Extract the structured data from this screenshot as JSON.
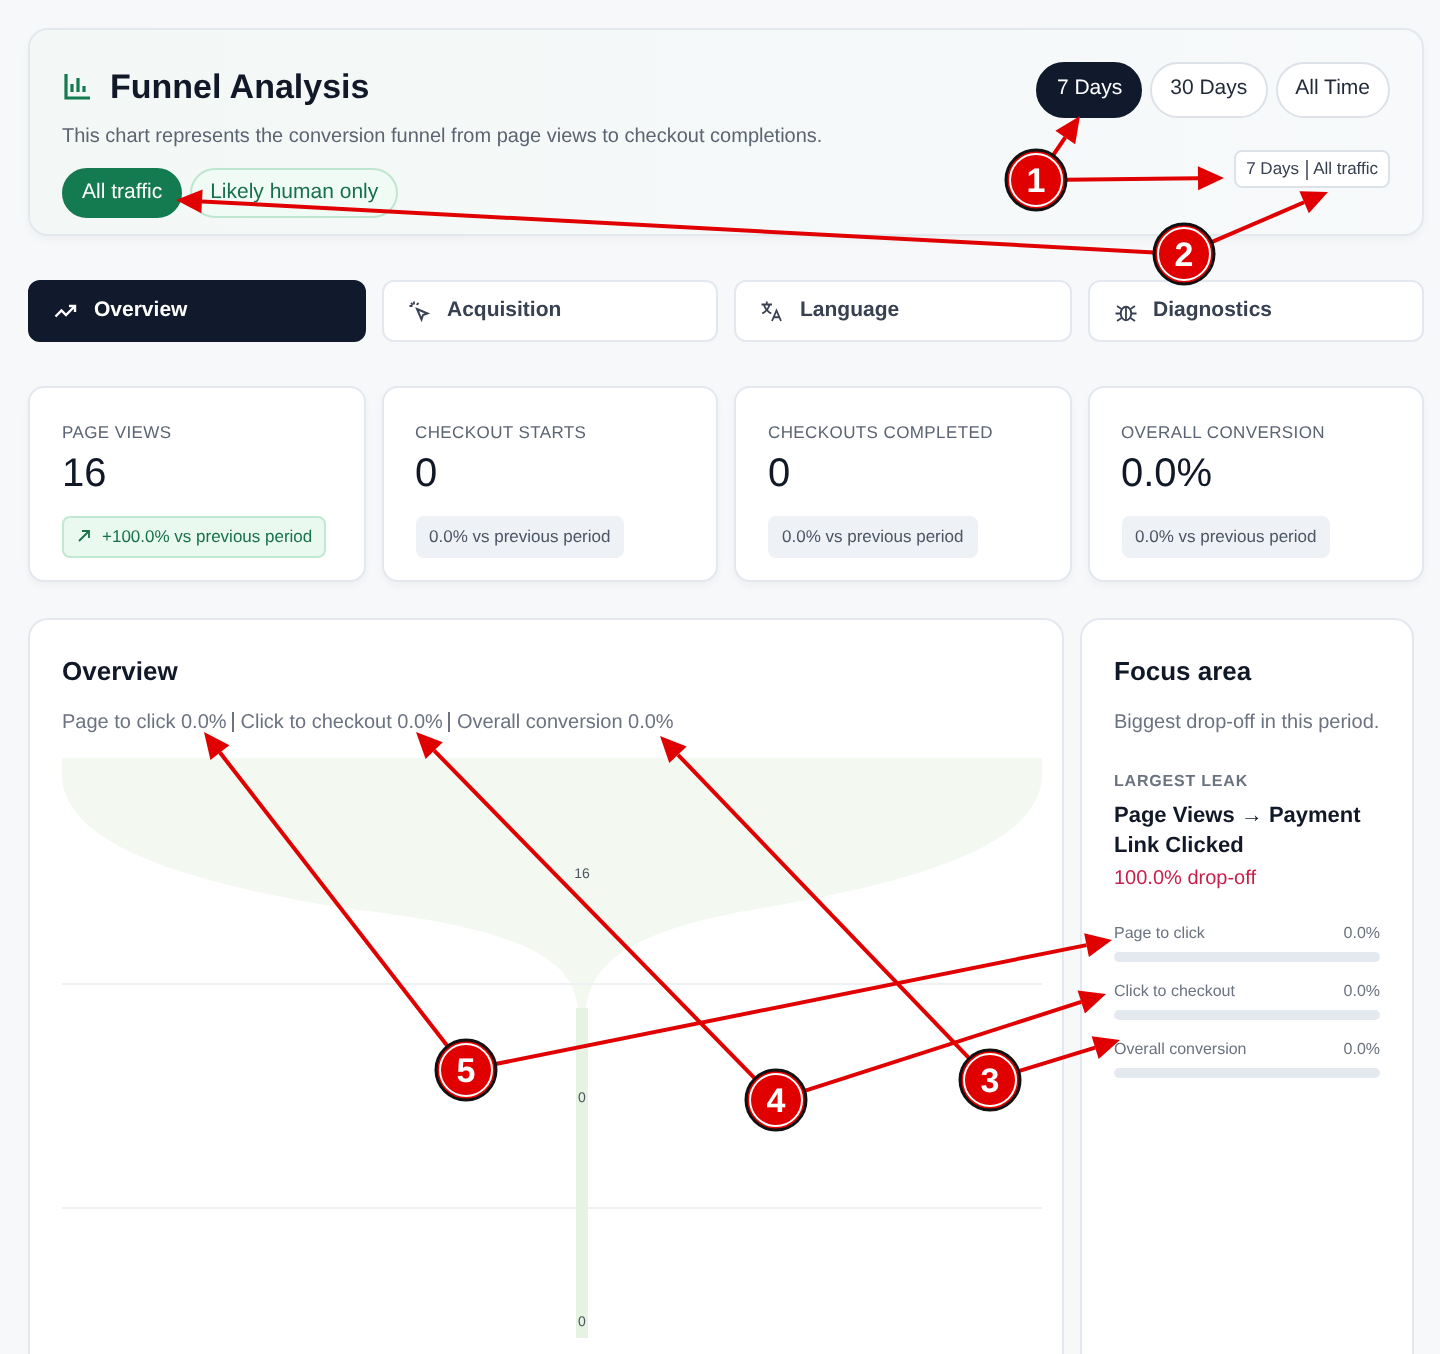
{
  "header": {
    "title": "Funnel Analysis",
    "description": "This chart represents the conversion funnel from page views to checkout completions.",
    "filters": [
      {
        "label": "All traffic",
        "selected": true
      },
      {
        "label": "Likely human only",
        "selected": false
      }
    ],
    "ranges": [
      {
        "label": "7 Days",
        "selected": true
      },
      {
        "label": "30 Days",
        "selected": false
      },
      {
        "label": "All Time",
        "selected": false
      }
    ],
    "summary": [
      "7 Days",
      "All traffic"
    ]
  },
  "tabs": [
    {
      "label": "Overview",
      "selected": true
    },
    {
      "label": "Acquisition",
      "selected": false
    },
    {
      "label": "Language",
      "selected": false
    },
    {
      "label": "Diagnostics",
      "selected": false
    }
  ],
  "stats": [
    {
      "label": "PAGE VIEWS",
      "value": "16",
      "delta": "+100.0% vs previous period",
      "kind": "positive"
    },
    {
      "label": "CHECKOUT STARTS",
      "value": "0",
      "delta": "0.0% vs previous period",
      "kind": "neutral"
    },
    {
      "label": "CHECKOUTS COMPLETED",
      "value": "0",
      "delta": "0.0% vs previous period",
      "kind": "neutral"
    },
    {
      "label": "OVERALL CONVERSION",
      "value": "0.0%",
      "delta": "0.0% vs previous period",
      "kind": "neutral"
    }
  ],
  "overview": {
    "title": "Overview",
    "rates": [
      "Page to click 0.0%",
      "Click to checkout 0.0%",
      "Overall conversion 0.0%"
    ],
    "stage_values": [
      "16",
      "0",
      "0"
    ]
  },
  "focus": {
    "title": "Focus area",
    "subtitle": "Biggest drop-off in this period.",
    "eyebrow": "LARGEST LEAK",
    "leak": "Page Views → Payment Link Clicked",
    "dropoff": "100.0% drop-off",
    "metrics": [
      {
        "label": "Page to click",
        "reading": "0.0%",
        "level": 0
      },
      {
        "label": "Click to checkout",
        "reading": "0.0%",
        "level": 0
      },
      {
        "label": "Overall conversion",
        "reading": "0.0%",
        "level": 0
      }
    ]
  },
  "annotations": [
    {
      "label": "1"
    },
    {
      "label": "2"
    },
    {
      "label": "3"
    },
    {
      "label": "4"
    },
    {
      "label": "5"
    }
  ]
}
